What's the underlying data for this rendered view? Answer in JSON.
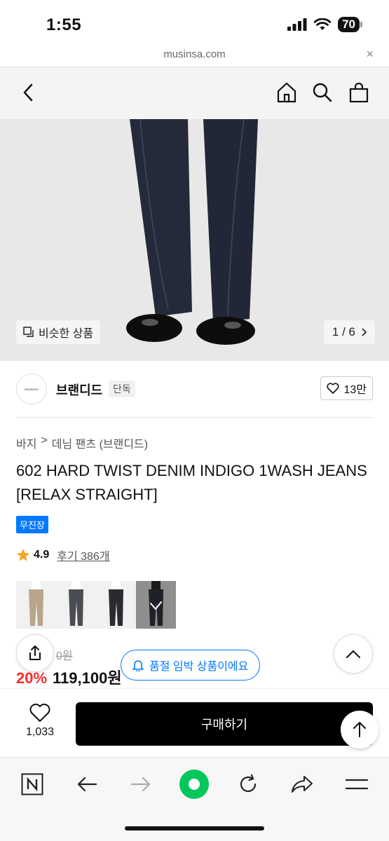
{
  "status_bar": {
    "time": "1:55",
    "battery": "70"
  },
  "url_bar": {
    "url": "musinsa.com",
    "close": "×"
  },
  "header": {
    "back_icon": "chevron-left-icon",
    "icons": [
      "home-icon",
      "search-icon",
      "cart-icon"
    ]
  },
  "gallery": {
    "similar_label": "비슷한 상품",
    "page": "1 / 6"
  },
  "brand": {
    "logo_text": "BRANDED",
    "name": "브랜디드",
    "tag": "단독",
    "likes": "13만"
  },
  "breadcrumb": {
    "category": "바지",
    "separator": ">",
    "subcategory": "데님 팬츠 (브랜디드)"
  },
  "product": {
    "title": "602 HARD TWIST DENIM INDIGO 1WASH JEANS [RELAX STRAIGHT]",
    "badge": "무진장",
    "rating": "4.9",
    "reviews": "후기 386개"
  },
  "variants": [
    {
      "name": "beige",
      "color": "#b8a58a"
    },
    {
      "name": "gray",
      "color": "#4a4d52"
    },
    {
      "name": "black",
      "color": "#2a2b2e"
    },
    {
      "name": "indigo",
      "color": "#1f2128",
      "selected": true
    }
  ],
  "price": {
    "original": "0원",
    "discount": "20%",
    "current": "119,100원"
  },
  "toast": {
    "text": "품절 임박 상품이에요"
  },
  "purchase": {
    "wish_count": "1,033",
    "buy_label": "구매하기"
  },
  "colors": {
    "accent": "#0078ff",
    "discount": "#f0312e",
    "buy": "#000000",
    "naver_green": "#03c75a"
  }
}
